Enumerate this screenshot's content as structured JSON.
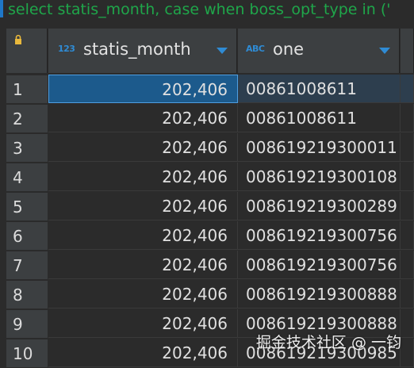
{
  "sql_bar": {
    "text": "select statis_month, case when boss_opt_type in ('"
  },
  "columns": [
    {
      "type_badge": "123",
      "name": "statis_month"
    },
    {
      "type_badge": "ABC",
      "name": "one"
    }
  ],
  "rows": [
    {
      "num": "1",
      "statis_month": "202,406",
      "one": "00861008611"
    },
    {
      "num": "2",
      "statis_month": "202,406",
      "one": "00861008611"
    },
    {
      "num": "3",
      "statis_month": "202,406",
      "one": "008619219300011"
    },
    {
      "num": "4",
      "statis_month": "202,406",
      "one": "008619219300108"
    },
    {
      "num": "5",
      "statis_month": "202,406",
      "one": "008619219300289"
    },
    {
      "num": "6",
      "statis_month": "202,406",
      "one": "008619219300756"
    },
    {
      "num": "7",
      "statis_month": "202,406",
      "one": "008619219300756"
    },
    {
      "num": "8",
      "statis_month": "202,406",
      "one": "008619219300888"
    },
    {
      "num": "9",
      "statis_month": "202,406",
      "one": "008619219300888"
    },
    {
      "num": "10",
      "statis_month": "202,406",
      "one": "008619219300985"
    }
  ],
  "selected_row": 1,
  "watermark": "掘金技术社区 @ 一钧",
  "icons": {
    "lock": "lock-icon",
    "number_type": "number-type-icon",
    "string_type": "string-type-icon",
    "sort": "sort-arrow-icon"
  },
  "colors": {
    "background": "#2b2b2b",
    "header": "#3c3f41",
    "accent_blue": "#2f8bd4",
    "selection": "#1c5a8c",
    "sql_green": "#1fa64a",
    "text": "#e0e0e0"
  }
}
